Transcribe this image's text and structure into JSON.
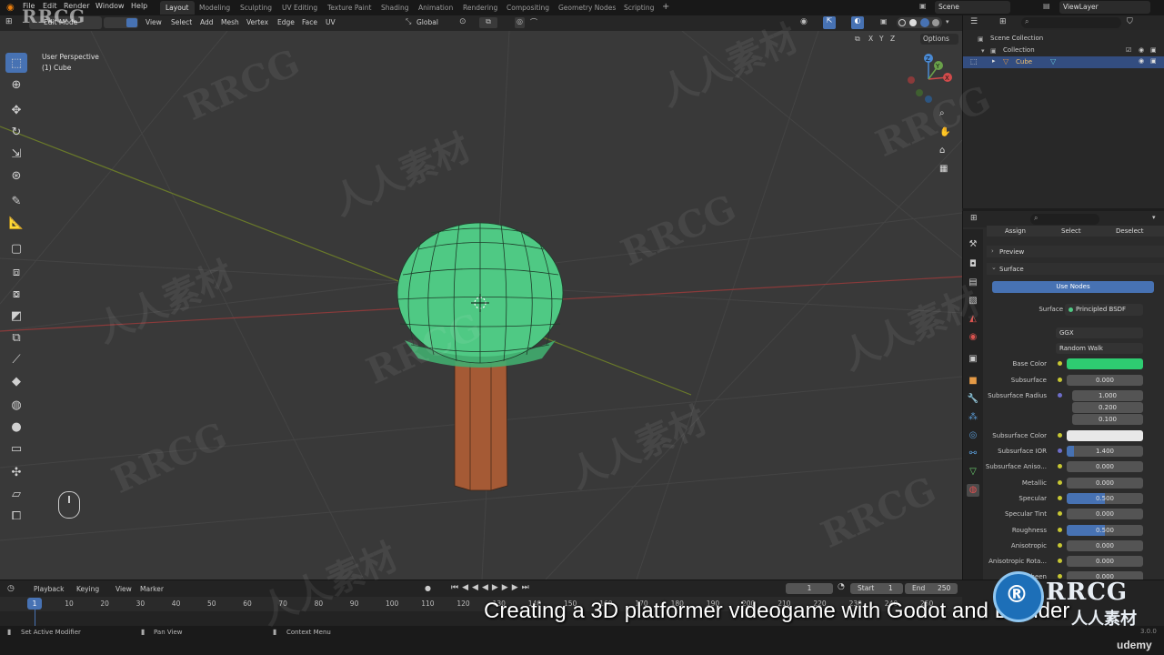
{
  "watermark": {
    "logo_text": "RRCG",
    "cn_text": "人人素材",
    "badge_cn": "人人素材"
  },
  "topbar": {
    "menus": [
      "File",
      "Edit",
      "Render",
      "Window",
      "Help"
    ],
    "workspaces": [
      "Layout",
      "Modeling",
      "Sculpting",
      "UV Editing",
      "Texture Paint",
      "Shading",
      "Animation",
      "Rendering",
      "Compositing",
      "Geometry Nodes",
      "Scripting"
    ],
    "scene": "Scene",
    "view_layer": "ViewLayer"
  },
  "viewport_header": {
    "mode": "Edit Mode",
    "menus": [
      "View",
      "Select",
      "Add",
      "Mesh",
      "Vertex",
      "Edge",
      "Face",
      "UV"
    ],
    "transform_orientation": "Global",
    "options": "Options",
    "axes": [
      "X",
      "Y",
      "Z"
    ]
  },
  "viewport": {
    "view_name": "User Perspective",
    "object_name": "(1) Cube",
    "gizmo_axes": [
      "Z",
      "Y",
      "X"
    ],
    "colors": {
      "foliage": "#4fc984",
      "trunk": "#a55a35",
      "background": "#393939"
    }
  },
  "toolbar": {
    "tools": [
      "select-box",
      "cursor",
      "move",
      "rotate",
      "scale",
      "transform",
      "annotate",
      "measure",
      "add-cube",
      "extrude",
      "inset",
      "bevel",
      "loop-cut",
      "knife",
      "poly-build",
      "spin",
      "smooth",
      "edge-slide",
      "shrink-fatten",
      "shear",
      "rip"
    ]
  },
  "outliner": {
    "items": [
      {
        "label": "Scene Collection",
        "level": 0
      },
      {
        "label": "Collection",
        "level": 1
      },
      {
        "label": "Cube",
        "level": 2,
        "selected": true
      }
    ]
  },
  "properties": {
    "buttons": [
      "Assign",
      "Select",
      "Deselect"
    ],
    "preview": "Preview",
    "surface_panel": "Surface",
    "use_nodes": "Use Nodes",
    "surface_label": "Surface",
    "surface_value": "Principled BSDF",
    "distribution": "GGX",
    "subsurface_method": "Random Walk",
    "base_color_label": "Base Color",
    "base_color": "#2ecc71",
    "rows": [
      {
        "label": "Subsurface",
        "value": "0.000",
        "fill": 0
      },
      {
        "label": "Subsurface Radius",
        "value": "1.000",
        "fill": 0
      },
      {
        "label": "",
        "value": "0.200",
        "fill": 0
      },
      {
        "label": "",
        "value": "0.100",
        "fill": 0
      },
      {
        "label": "Subsurface Color",
        "value": "",
        "fill": 0
      },
      {
        "label": "Subsurface IOR",
        "value": "1.400",
        "fill": 0.1
      },
      {
        "label": "Subsurface Aniso...",
        "value": "0.000",
        "fill": 0
      },
      {
        "label": "Metallic",
        "value": "0.000",
        "fill": 0
      },
      {
        "label": "Specular",
        "value": "0.500",
        "fill": 0.5
      },
      {
        "label": "Specular Tint",
        "value": "0.000",
        "fill": 0
      },
      {
        "label": "Roughness",
        "value": "0.500",
        "fill": 0.5
      },
      {
        "label": "Anisotropic",
        "value": "0.000",
        "fill": 0
      },
      {
        "label": "Anisotropic Rota...",
        "value": "0.000",
        "fill": 0
      },
      {
        "label": "Sheen",
        "value": "0.000",
        "fill": 0
      }
    ]
  },
  "timeline": {
    "menus": [
      "Playback",
      "Keying",
      "View",
      "Marker"
    ],
    "current_frame": "1",
    "start_label": "Start",
    "start": "1",
    "end_label": "End",
    "end": "250",
    "ticks": [
      "1",
      "10",
      "20",
      "30",
      "40",
      "50",
      "60",
      "70",
      "80",
      "90",
      "100",
      "110",
      "120",
      "130",
      "140",
      "150",
      "160",
      "170",
      "180",
      "190",
      "200",
      "210",
      "220",
      "230",
      "240",
      "250"
    ]
  },
  "statusbar": {
    "items": [
      "Set Active Modifier",
      "Pan View",
      "Context Menu"
    ],
    "version": "3.0.0"
  },
  "caption": "Creating a 3D platformer videogame with Godot and Blender",
  "brand": "udemy"
}
